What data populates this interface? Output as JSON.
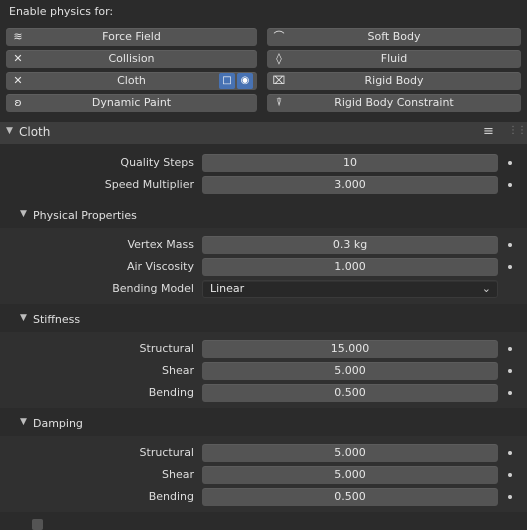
{
  "enable_label": "Enable physics for:",
  "physics_buttons": [
    {
      "label": "Force Field",
      "icon": "force-field-icon",
      "glyph": "≋"
    },
    {
      "label": "Soft Body",
      "icon": "soft-body-icon",
      "glyph": "⌒"
    },
    {
      "label": "Collision",
      "icon": "close-icon",
      "glyph": "✕"
    },
    {
      "label": "Fluid",
      "icon": "fluid-drop-icon",
      "glyph": "◊"
    },
    {
      "label": "Cloth",
      "icon": "close-icon",
      "glyph": "✕"
    },
    {
      "label": "Rigid Body",
      "icon": "rigid-body-icon",
      "glyph": "⌧"
    },
    {
      "label": "Dynamic Paint",
      "icon": "dynamic-paint-icon",
      "glyph": "ʚ"
    },
    {
      "label": "Rigid Body Constraint",
      "icon": "rigid-body-constraint-icon",
      "glyph": "⍒"
    }
  ],
  "cloth_toggles": {
    "viewport_icon": "monitor-icon",
    "render_icon": "camera-icon"
  },
  "panel": {
    "title": "Cloth"
  },
  "main_props": [
    {
      "label": "Quality Steps",
      "value": "10"
    },
    {
      "label": "Speed Multiplier",
      "value": "3.000"
    }
  ],
  "physical": {
    "title": "Physical Properties",
    "props": [
      {
        "label": "Vertex Mass",
        "value": "0.3 kg"
      },
      {
        "label": "Air Viscosity",
        "value": "1.000"
      }
    ],
    "bending_model": {
      "label": "Bending Model",
      "value": "Linear"
    }
  },
  "stiffness": {
    "title": "Stiffness",
    "props": [
      {
        "label": "Structural",
        "value": "15.000"
      },
      {
        "label": "Shear",
        "value": "5.000"
      },
      {
        "label": "Bending",
        "value": "0.500"
      }
    ]
  },
  "damping": {
    "title": "Damping",
    "props": [
      {
        "label": "Structural",
        "value": "5.000"
      },
      {
        "label": "Shear",
        "value": "5.000"
      },
      {
        "label": "Bending",
        "value": "0.500"
      }
    ]
  },
  "colors": {
    "accent": "#4772b3",
    "background": "#2b2b2b",
    "field": "#545454"
  }
}
